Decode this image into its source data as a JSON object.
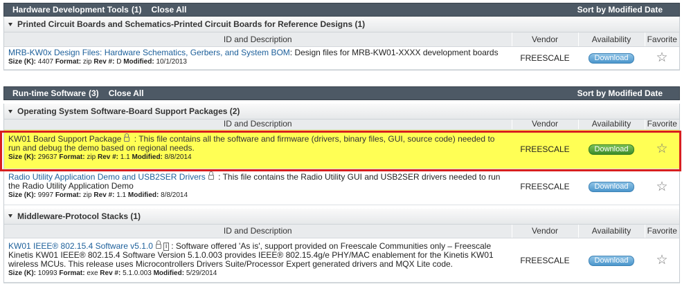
{
  "colors": {
    "header_bg": "#4d5965",
    "link": "#1c5f9a",
    "highlight": "#ffff55",
    "highlight_border": "#d81f1f",
    "download_blue": "#4b96cc",
    "download_green": "#3b8c2a"
  },
  "columns": {
    "id": "ID and Description",
    "vendor": "Vendor",
    "availability": "Availability",
    "favorite": "Favorite"
  },
  "hw": {
    "title": "Hardware Development Tools",
    "count": "(1)",
    "close_all": "Close All",
    "sort": "Sort by Modified Date",
    "group": "Printed Circuit Boards and Schematics-Printed Circuit Boards for Reference Designs (1)",
    "rows": [
      {
        "title": "MRB-KW0x Design Files: Hardware Schematics, Gerbers, and System BOM",
        "desc": ": Design files for MRB-KW01-XXXX development boards",
        "meta": "4407",
        "format": "zip",
        "rev": "D",
        "modified": "10/1/2013",
        "vendor": "FREESCALE",
        "download": "Download"
      }
    ]
  },
  "rt": {
    "title": "Run-time Software",
    "count": "(3)",
    "close_all": "Close All",
    "sort": "Sort by Modified Date",
    "group": "Operating System Software-Board Support Packages (2)",
    "rows": [
      {
        "title": "KW01 Board Support Package",
        "desc": " : This file contains all the software and firmware (drivers, binary files, GUI, source code) needed to run and debug the demo based on regional needs.",
        "meta": "29637",
        "format": "zip",
        "rev": "1.1",
        "modified": "8/8/2014",
        "vendor": "FREESCALE",
        "download": "Download"
      },
      {
        "title": "Radio Utility Application Demo and USB2SER Drivers",
        "desc": " : This file contains the Radio Utility GUI and USB2SER drivers needed to run the Radio Utility Application Demo",
        "meta": "9997",
        "format": "zip",
        "rev": "1.1",
        "modified": "8/8/2014",
        "vendor": "FREESCALE",
        "download": "Download"
      }
    ],
    "group2": "Middleware-Protocol Stacks (1)",
    "rows2": [
      {
        "title": "KW01 IEEE® 802.15.4 Software v5.1.0",
        "desc": ": Software offered 'As is', support provided on Freescale Communities only – Freescale Kinetis KW01 IEEE® 802.15.4 Software Version 5.1.0.003 provides IEEE® 802.15.4g/e PHY/MAC enablement for the Kinetis KW01 wireless MCUs. This release uses Microcontrollers Drivers Suite/Processor Expert generated drivers and MQX Lite code.",
        "meta": "10993",
        "format": "exe",
        "rev": "5.1.0.003",
        "modified": "5/29/2014",
        "vendor": "FREESCALE",
        "download": "Download",
        "info": "i"
      }
    ]
  },
  "labels": {
    "size": "Size (K):",
    "format": "Format:",
    "rev": "Rev #:",
    "modified": "Modified:"
  }
}
